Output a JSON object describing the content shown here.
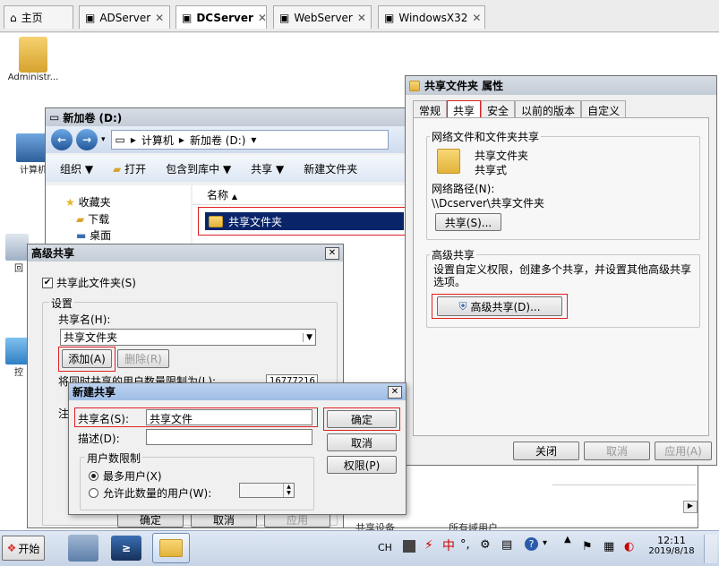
{
  "tabs": [
    {
      "label": "主页",
      "close": ""
    },
    {
      "label": "ADServer",
      "close": "✕"
    },
    {
      "label": "DCServer",
      "close": "✕"
    },
    {
      "label": "WebServer",
      "close": "✕"
    },
    {
      "label": "WindowsX32",
      "close": "✕"
    }
  ],
  "desktop": {
    "admin_label": "Administr...",
    "computer_label": "计算机",
    "recycle_label": "回",
    "control_label": "控"
  },
  "explorer": {
    "title": "新加卷 (D:)",
    "address": [
      "计算机",
      "新加卷 (D:)"
    ],
    "toolbar": [
      "组织 ▼",
      "打开",
      "包含到库中 ▼",
      "共享 ▼",
      "新建文件夹"
    ],
    "nav": {
      "favorites": "收藏夹",
      "downloads": "下载",
      "desktop": "桌面"
    },
    "column": "名称",
    "file": "共享文件夹",
    "partial": "共享设备",
    "partial2": "所有域用户"
  },
  "props": {
    "title": "共享文件夹 属性",
    "tabs": [
      "常规",
      "共享",
      "安全",
      "以前的版本",
      "自定义"
    ],
    "net_group": "网络文件和文件夹共享",
    "folder_name": "共享文件夹",
    "folder_state": "共享式",
    "path_label": "网络路径(N):",
    "path": "\\\\Dcserver\\共享文件夹",
    "share_btn": "共享(S)...",
    "adv_group": "高级共享",
    "adv_desc": "设置自定义权限，创建多个共享，并设置其他高级共享选项。",
    "adv_btn": "高级共享(D)...",
    "ok": "关闭",
    "cancel": "取消",
    "apply": "应用(A)"
  },
  "advanced": {
    "title": "高级共享",
    "share_check": "共享此文件夹(S)",
    "check_mark": "✔",
    "settings": "设置",
    "share_name_label": "共享名(H):",
    "share_name": "共享文件夹",
    "add": "添加(A)",
    "remove": "删除(R)",
    "limit_label": "将同时共享的用户数量限制为(L):",
    "limit_value": "16777216",
    "comment_label": "注",
    "ok": "确定",
    "cancel": "取消",
    "apply": "应用"
  },
  "newshare": {
    "title": "新建共享",
    "name_label": "共享名(S):",
    "name_value": "共享文件",
    "desc_label": "描述(D):",
    "desc_value": "",
    "limit_group": "用户数限制",
    "opt_max": "最多用户(X)",
    "opt_allow": "允许此数量的用户(W):",
    "ok": "确定",
    "cancel": "取消",
    "perm": "权限(P)"
  },
  "taskbar": {
    "start": "开始",
    "lang": "CH",
    "ime": "中",
    "time": "12:11",
    "date": "2019/8/18"
  }
}
